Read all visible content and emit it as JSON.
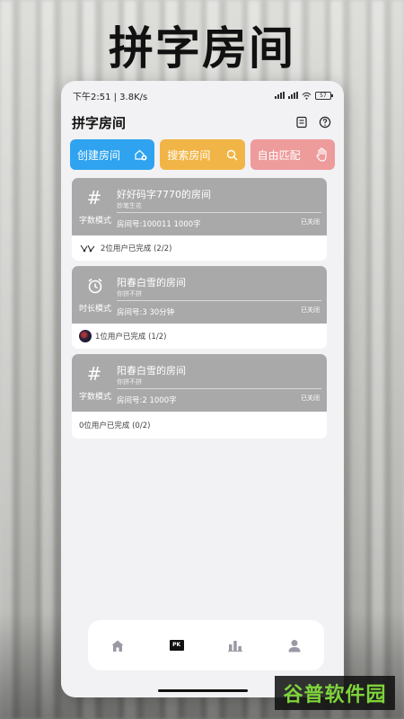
{
  "headline": "拼字房间",
  "status_bar": {
    "time_speed": "下午2:51 | 3.8K/s",
    "battery": "57"
  },
  "app": {
    "title": "拼字房间",
    "icons": [
      "list-icon",
      "help-icon"
    ]
  },
  "actions": [
    {
      "label": "创建房间",
      "icon": "house-plus-icon",
      "color": "#2fa3ef"
    },
    {
      "label": "搜索房间",
      "icon": "search-icon",
      "color": "#f1b547"
    },
    {
      "label": "自由匹配",
      "icon": "hand-icon",
      "color": "#ee9b9b"
    }
  ],
  "rooms": [
    {
      "mode_icon": "#",
      "mode": "字数模式",
      "name": "好好码字7770的房间",
      "subtitle": "妙笔生花",
      "info": "房间号:100011   1000字",
      "status": "已关闭",
      "completion": "2位用户已完成 (2/2)"
    },
    {
      "mode_icon": "alarm-clock-icon",
      "mode": "时长模式",
      "name": "阳春白雪的房间",
      "subtitle": "你拼不拼",
      "info": "房间号:3    30分钟",
      "status": "已关闭",
      "completion": "1位用户已完成 (1/2)"
    },
    {
      "mode_icon": "#",
      "mode": "字数模式",
      "name": "阳春白雪的房间",
      "subtitle": "你拼不拼",
      "info": "房间号:2    1000字",
      "status": "已关闭",
      "completion": "0位用户已完成 (0/2)"
    }
  ],
  "tabbar": {
    "items": [
      "home-icon",
      "pk-icon",
      "ranking-icon",
      "profile-icon"
    ],
    "pk_label": "PK"
  },
  "watermark": "谷普软件园"
}
